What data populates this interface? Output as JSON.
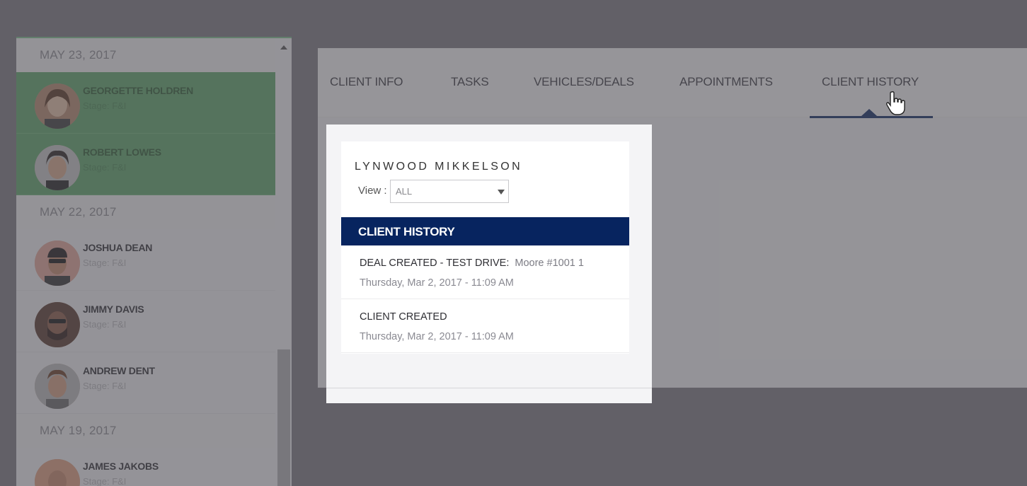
{
  "client_list": {
    "groups": [
      {
        "date": "MAY 23, 2017",
        "clients": [
          {
            "name": "GEORGETTE HOLDREN",
            "stage": "Stage: F&I",
            "selected": true
          },
          {
            "name": "ROBERT LOWES",
            "stage": "Stage: F&I",
            "selected": true
          }
        ]
      },
      {
        "date": "MAY 22, 2017",
        "clients": [
          {
            "name": "JOSHUA DEAN",
            "stage": "Stage: F&I",
            "selected": false
          },
          {
            "name": "JIMMY DAVIS",
            "stage": "Stage: F&I",
            "selected": false
          },
          {
            "name": "ANDREW DENT",
            "stage": "Stage: F&I",
            "selected": false
          }
        ]
      },
      {
        "date": "MAY 19, 2017",
        "clients": [
          {
            "name": "JAMES JAKOBS",
            "stage": "Stage: F&I",
            "selected": false
          }
        ]
      }
    ]
  },
  "tabs": [
    {
      "label": "CLIENT INFO"
    },
    {
      "label": "TASKS"
    },
    {
      "label": "VEHICLES/DEALS"
    },
    {
      "label": "APPOINTMENTS"
    },
    {
      "label": "CLIENT HISTORY",
      "active": true
    }
  ],
  "client_card": {
    "name": "LYNWOOD MIKKELSON",
    "view_label": "View :",
    "view_value": "ALL",
    "history_title": "CLIENT HISTORY",
    "entries": [
      {
        "label": "DEAL CREATED - TEST DRIVE:",
        "detail": "Moore #1001 1",
        "time": "Thursday, Mar 2, 2017 - 11:09 AM"
      },
      {
        "label": "CLIENT CREATED",
        "detail": "",
        "time": "Thursday, Mar 2, 2017 - 11:09 AM"
      }
    ]
  },
  "colors": {
    "accent_navy": "#07245f",
    "selected_green": "#5ea86a"
  }
}
